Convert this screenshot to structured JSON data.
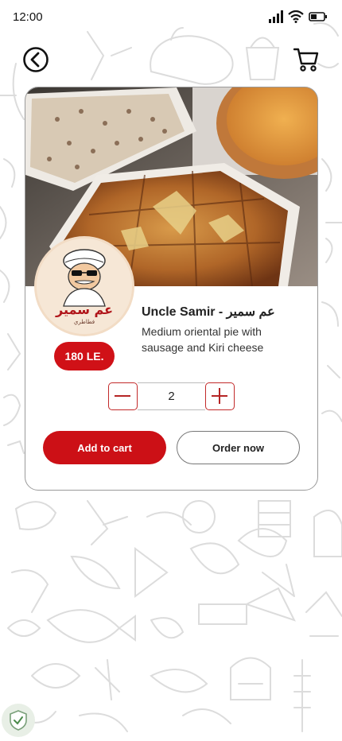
{
  "status_bar": {
    "time": "12:00"
  },
  "product": {
    "title": "Uncle Samir - عم سمير",
    "description": "Medium oriental pie with sausage and Kiri cheese",
    "price": "180 LE.",
    "quantity": "2"
  },
  "actions": {
    "add_to_cart": "Add to cart",
    "order_now": "Order now"
  },
  "logo": {
    "text_main": "عم سمير",
    "text_sub": "فطاطري"
  },
  "colors": {
    "brand_red": "#cc1016",
    "stepper_border": "#c22a2a",
    "doodle_gray": "#d9d9d9"
  },
  "icons": [
    "back-icon",
    "cart-icon",
    "minus-icon",
    "plus-icon",
    "signal-icon",
    "wifi-icon",
    "battery-icon",
    "shield-icon"
  ]
}
